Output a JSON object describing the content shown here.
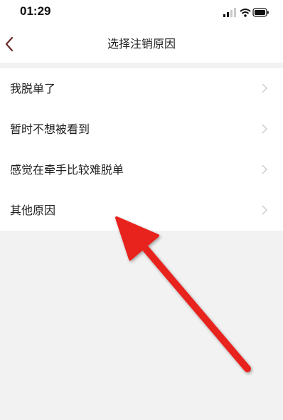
{
  "status_bar": {
    "time": "01:29",
    "icons": [
      "signal-icon",
      "wifi-icon",
      "battery-icon"
    ]
  },
  "nav": {
    "title": "选择注销原因",
    "back_icon": "chevron-left-icon"
  },
  "reasons": [
    {
      "label": "我脱单了"
    },
    {
      "label": "暂时不想被看到"
    },
    {
      "label": "感觉在牵手比较难脱单"
    },
    {
      "label": "其他原因"
    }
  ],
  "colors": {
    "background": "#f2f2f2",
    "surface": "#ffffff",
    "text": "#1f1f1f",
    "chevron": "#c8c8c8",
    "back_icon": "#6b2d2d",
    "annotation_arrow": "#e8211f"
  }
}
